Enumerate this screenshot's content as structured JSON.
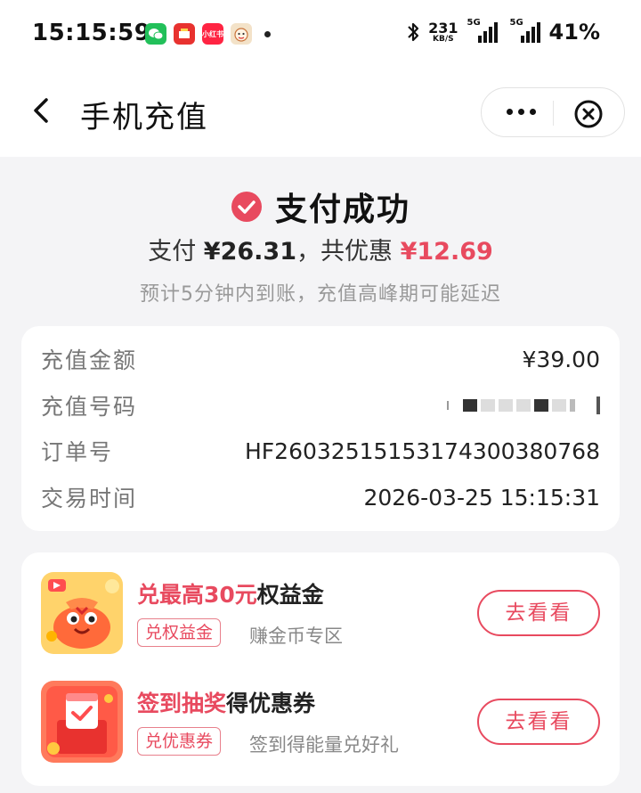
{
  "status_bar": {
    "time": "15:15:59",
    "net_speed": "231",
    "net_unit": "KB/S",
    "network_1": "5G",
    "network_2": "5G",
    "battery": "41%",
    "app_icons": [
      "wechat-icon",
      "app-red-icon",
      "xiaohongshu-icon",
      "cartoon-app-icon"
    ],
    "xiaohongshu_label": "小红书"
  },
  "navbar": {
    "title": "手机充值"
  },
  "result": {
    "title": "支付成功",
    "pay_prefix": "支付 ",
    "pay_amount": "¥26.31",
    "pay_mid": "，共优惠 ",
    "discount": "¥12.69",
    "note": "预计5分钟内到账，充值高峰期可能延迟"
  },
  "details": {
    "rows": [
      {
        "label": "充值金额",
        "value": "¥39.00"
      },
      {
        "label": "充值号码",
        "value": ""
      },
      {
        "label": "订单号",
        "value": "HF26032515153174300380768"
      },
      {
        "label": "交易时间",
        "value": "2026-03-25 15:15:31"
      }
    ]
  },
  "promos": [
    {
      "title_hl": "兑最高30元",
      "title_rest": "权益金",
      "tag": "兑权益金",
      "sub": "赚金币专区",
      "button": "去看看"
    },
    {
      "title_hl": "签到抽奖",
      "title_rest": "得优惠券",
      "tag": "兑优惠券",
      "sub": "签到得能量兑好礼",
      "button": "去看看"
    }
  ],
  "colors": {
    "accent": "#e84a5f",
    "background": "#f4f4f6"
  }
}
